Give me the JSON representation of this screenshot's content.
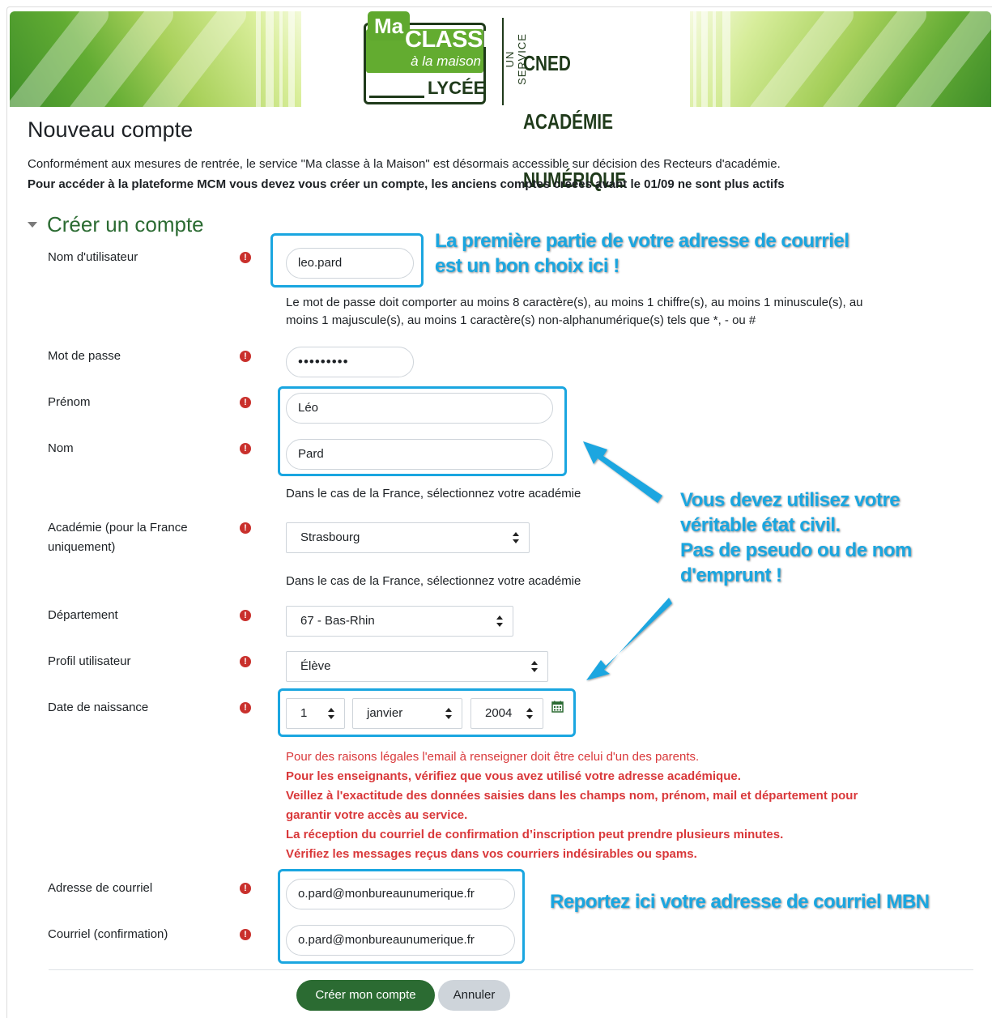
{
  "banner": {
    "logo_ma": "Ma",
    "logo_classe": "CLASSE",
    "logo_maison": "à la maison",
    "logo_lycee": "LYCÉE",
    "logo_service": "UN SERVICE",
    "logo_cned_lines": [
      "CNED",
      "ACADÉMIE",
      "NUMÉRIQUE"
    ]
  },
  "page_title": "Nouveau compte",
  "intro_line_1": "Conformément aux mesures de rentrée, le service \"Ma classe à la Maison\" est désormais accessible sur décision des Recteurs d'académie.",
  "intro_line_2": "Pour accéder à la plateforme MCM vous devez vous créer un compte, les anciens comptes créées avant le 01/09 ne sont plus actifs",
  "section_title": "Créer un compte",
  "required_icon": "exclamation-circle-icon",
  "fields": {
    "username": {
      "label": "Nom d'utilisateur",
      "value": "leo.pard"
    },
    "password_help_1": "Le mot de passe doit comporter au moins 8 caractère(s), au moins 1 chiffre(s), au moins 1 minuscule(s), au",
    "password_help_2": "moins 1 majuscule(s), au moins 1 caractère(s) non-alphanumérique(s) tels que *, - ou #",
    "password": {
      "label": "Mot de passe",
      "value": "•••••••••"
    },
    "firstname": {
      "label": "Prénom",
      "value": "Léo"
    },
    "lastname": {
      "label": "Nom",
      "value": "Pard"
    },
    "academy_help": "Dans le cas de la France, sélectionnez votre académie",
    "academy": {
      "label_1": "Académie (pour la France",
      "label_2": "uniquement)",
      "value": "Strasbourg"
    },
    "department_help": "Dans le cas de la France, sélectionnez votre académie",
    "department": {
      "label": "Département",
      "value": "67 - Bas-Rhin"
    },
    "profile": {
      "label": "Profil utilisateur",
      "value": "Élève"
    },
    "birthdate": {
      "label": "Date de naissance",
      "day": "1",
      "month": "janvier",
      "year": "2004"
    },
    "email": {
      "label": "Adresse de courriel",
      "value": "o.pard@monbureaunumerique.fr"
    },
    "email_confirm": {
      "label": "Courriel (confirmation)",
      "value": "o.pard@monbureaunumerique.fr"
    }
  },
  "email_notice": {
    "line_1": "Pour des raisons légales l'email à renseigner doit être celui d'un des parents.",
    "line_2": "Pour les enseignants, vérifiez que vous avez utilisé votre adresse académique.",
    "line_3": "Veillez à l'exactitude des données saisies dans les champs nom, prénom, mail et département pour",
    "line_4": "garantir votre accès au service.",
    "line_5": "La réception du courriel de confirmation d’inscription peut prendre plusieurs minutes.",
    "line_6": "Vérifiez les messages reçus dans vos courriers indésirables ou spams."
  },
  "callouts": {
    "username_1": "La première partie de votre adresse de courriel",
    "username_2": "est un bon choix ici !",
    "identity_1": "Vous devez utilisez votre",
    "identity_2": "véritable état civil.",
    "identity_3": "Pas de pseudo ou de nom",
    "identity_4": "d'emprunt !",
    "email": "Reportez ici votre adresse de courriel MBN"
  },
  "buttons": {
    "submit": "Créer mon compte",
    "cancel": "Annuler"
  },
  "colors": {
    "primary": "#2b6b32",
    "required": "#c9302c",
    "callout": "#1aa6e0",
    "notice": "#d9383a"
  }
}
